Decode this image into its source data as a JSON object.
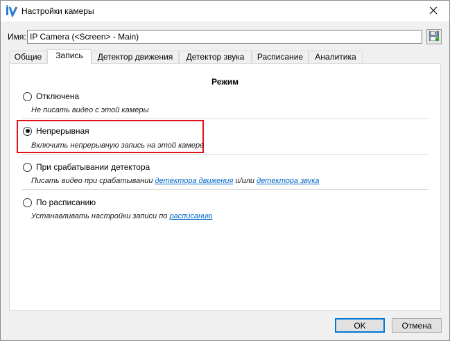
{
  "window": {
    "title": "Настройки камеры",
    "app_icon": "iv-logo-icon",
    "close_icon": "close-icon"
  },
  "name_field": {
    "label": "Имя:",
    "value": "IP Camera (<Screen> - Main)",
    "save_icon": "save-disk-icon"
  },
  "tabs": [
    {
      "label": "Общие",
      "active": false
    },
    {
      "label": "Запись",
      "active": true
    },
    {
      "label": "Детектор движения",
      "active": false
    },
    {
      "label": "Детектор звука",
      "active": false
    },
    {
      "label": "Расписание",
      "active": false
    },
    {
      "label": "Аналитика",
      "active": false
    }
  ],
  "recording": {
    "section_title": "Режим",
    "options": [
      {
        "label": "Отключена",
        "description": "Не писать видео с этой камеры",
        "checked": false
      },
      {
        "label": "Непрерывная",
        "description": "Включить непрерывную запись на этой камере",
        "checked": true
      },
      {
        "label": "При срабатывании детектора",
        "desc_prefix": "Писать видео при срабатывании ",
        "desc_link1": "детектора движения",
        "desc_mid": " и/или ",
        "desc_link2": "детектора звука",
        "checked": false
      },
      {
        "label": "По расписанию",
        "desc_prefix": "Устанавливать настройки записи по ",
        "desc_link1": "расписанию",
        "checked": false
      }
    ],
    "highlight_color": "#e0101a"
  },
  "buttons": {
    "ok": "OK",
    "cancel": "Отмена"
  },
  "colors": {
    "link": "#0066cc",
    "accent": "#0078d7"
  }
}
